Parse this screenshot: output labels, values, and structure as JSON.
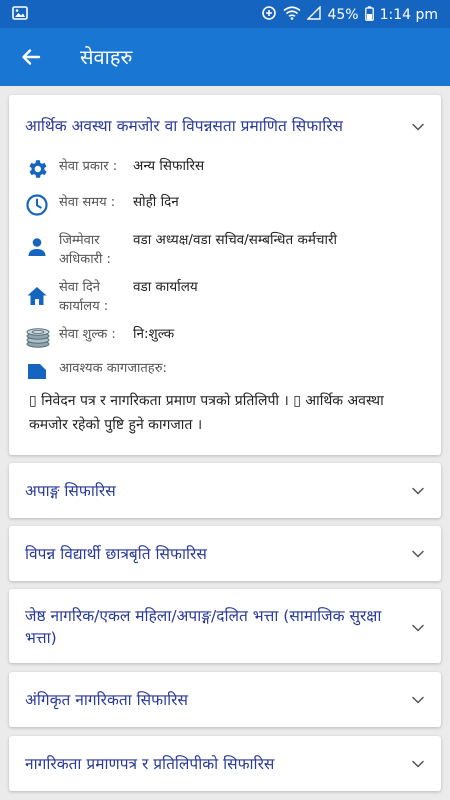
{
  "status_bar": {
    "battery": "45%",
    "time": "1:14 pm"
  },
  "app_bar": {
    "title": "सेवाहरु"
  },
  "expanded_service": {
    "title": "आर्थिक अवस्था कमजोर वा विपन्नसता प्रमाणित सिफारिस",
    "rows": [
      {
        "icon": "gear-icon",
        "label": "सेवा प्रकार :",
        "value": "अन्य सिफारिस"
      },
      {
        "icon": "clock-icon",
        "label": "सेवा समय :",
        "value": "सोही दिन"
      },
      {
        "icon": "person-icon",
        "label": "जिम्मेवार अधिकारी :",
        "value": "वडा अध्यक्ष/वडा सचिव/सम्बन्धित कर्मचारी"
      },
      {
        "icon": "home-icon",
        "label": "सेवा दिने कार्यालय :",
        "value": "वडा कार्यालय"
      },
      {
        "icon": "coins-icon",
        "label": "सेवा शुल्क :",
        "value": "नि:शुल्क"
      }
    ],
    "docs_label": "आवश्यक कागजातहरु:",
    "docs_text": "▯ निवेदन पत्र र नागरिकता प्रमाण पत्रको प्रतिलिपी । ▯ आर्थिक अवस्था कमजोर रहेको पुष्टि हुने कागजात ।"
  },
  "services": [
    {
      "title": "अपाङ्ग सिफारिस"
    },
    {
      "title": "विपन्न विद्यार्थी छात्रबृति सिफारिस"
    },
    {
      "title": "जेष्ठ नागरिक/एकल महिला/अपाङ्ग/दलित भत्ता (सामाजिक सुरक्षा भत्ता)"
    },
    {
      "title": "अंगिकृत नागरिकता सिफारिस"
    },
    {
      "title": "नागरिकता प्रमाणपत्र र प्रतिलिपीको सिफारिस"
    }
  ],
  "colors": {
    "app_bar": "#1976d2",
    "status_bar": "#1565c0",
    "accent_icon": "#1565c0",
    "title_text": "#2a3a9a"
  }
}
